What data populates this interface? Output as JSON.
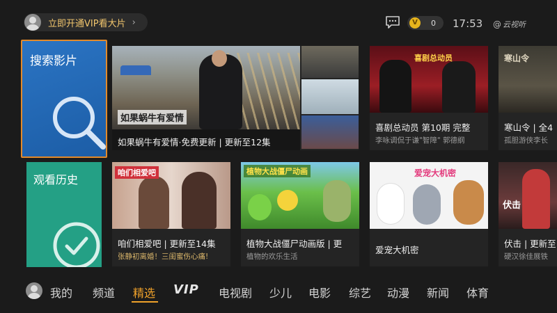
{
  "topbar": {
    "vip_text": "立即开通VIP看大片",
    "vip_chevron": "›",
    "coin_symbol": "V",
    "coin_count": "0",
    "time": "17:53",
    "brand": "云视听",
    "brand_icon": "@"
  },
  "tiles": {
    "search": {
      "label": "搜索影片",
      "icon": "magnifier-icon",
      "color": "#2169b5",
      "border": "#e38a2a"
    },
    "history": {
      "label": "观看历史",
      "icon": "checkmark-icon",
      "color": "#24a085"
    }
  },
  "cards": {
    "featured": {
      "caption": "如果蜗牛有爱情·免费更新 | 更新至12集",
      "poster_text": "如果蜗牛有爱情"
    },
    "comedy": {
      "caption": "喜剧总动员 第10期 完整",
      "subcaption": "李咏调侃于谦\"智障\" 郭德纲",
      "poster_text": "喜剧总动员"
    },
    "hanshanling": {
      "caption": "寒山令 | 全4",
      "subcaption": "孤胆游侠李长",
      "poster_text": "寒山令"
    },
    "xiangai": {
      "caption": "咱们相爱吧 | 更新至14集",
      "subcaption": "张静初离婚！三闺蜜伤心痛!",
      "poster_text": "咱们相爱吧"
    },
    "plants": {
      "caption": "植物大战僵尸动画版 | 更",
      "subcaption": "植物的欢乐生活",
      "poster_text": "植物大战僵尸动画"
    },
    "pets": {
      "caption": "爱宠大机密",
      "poster_text": "爱宠大机密"
    },
    "fuji": {
      "caption": "伏击 | 更新至",
      "subcaption": "硬汉徐佳展铁",
      "poster_text": "伏击"
    }
  },
  "nav": {
    "items": [
      "我的",
      "频道",
      "精选",
      "VIP",
      "电视剧",
      "少儿",
      "电影",
      "综艺",
      "动漫",
      "新闻",
      "体育"
    ],
    "active": "精选",
    "active_color": "#f0a22a"
  }
}
